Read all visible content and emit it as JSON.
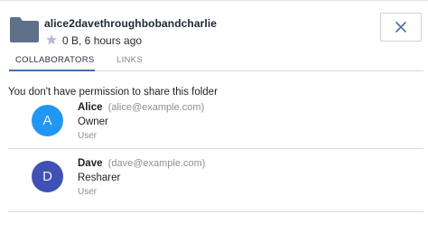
{
  "header": {
    "title": "alice2davethroughbobandcharlie",
    "meta": "0 B, 6 hours ago",
    "folder_icon": "folder-icon",
    "star_icon": "star-icon",
    "close_icon": "close-icon"
  },
  "tabs": [
    {
      "label": "COLLABORATORS",
      "active": true
    },
    {
      "label": "LINKS",
      "active": false
    }
  ],
  "notice": "You don't have permission to share this folder",
  "collaborators": [
    {
      "initial": "A",
      "name": "Alice",
      "email": "(alice@example.com)",
      "role": "Owner",
      "type": "User",
      "avatar_color": "#2196f3"
    },
    {
      "initial": "D",
      "name": "Dave",
      "email": "(dave@example.com)",
      "role": "Resharer",
      "type": "User",
      "avatar_color": "#3f51b5"
    }
  ],
  "colors": {
    "folder": "#5f7189",
    "star": "#b7bec8",
    "tab_underline": "#4a6fa5"
  }
}
